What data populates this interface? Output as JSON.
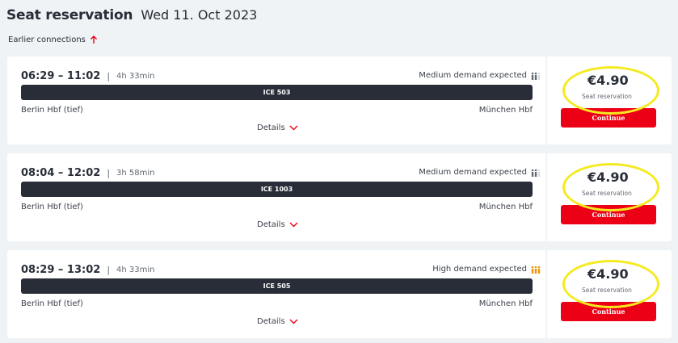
{
  "header": {
    "title": "Seat reservation",
    "date": "Wed 11. Oct 2023"
  },
  "earlier_connections": "Earlier connections",
  "colors": {
    "accent": "#ec0016",
    "train_bar": "#282d37",
    "highlight": "#f5ea20",
    "high_demand": "#f39200"
  },
  "connections": [
    {
      "time_range": "06:29 – 11:02",
      "duration": "4h 33min",
      "demand": "Medium demand expected",
      "demand_level": "medium",
      "train": "ICE 503",
      "from": "Berlin Hbf (tief)",
      "to": "München Hbf",
      "details": "Details",
      "price": "€4.90",
      "price_label": "Seat reservation",
      "continue": "Continue"
    },
    {
      "time_range": "08:04 – 12:02",
      "duration": "3h 58min",
      "demand": "Medium demand expected",
      "demand_level": "medium",
      "train": "ICE 1003",
      "from": "Berlin Hbf (tief)",
      "to": "München Hbf",
      "details": "Details",
      "price": "€4.90",
      "price_label": "Seat reservation",
      "continue": "Continue"
    },
    {
      "time_range": "08:29 – 13:02",
      "duration": "4h 33min",
      "demand": "High demand expected",
      "demand_level": "high",
      "train": "ICE 505",
      "from": "Berlin Hbf (tief)",
      "to": "München Hbf",
      "details": "Details",
      "price": "€4.90",
      "price_label": "Seat reservation",
      "continue": "Continue"
    }
  ]
}
